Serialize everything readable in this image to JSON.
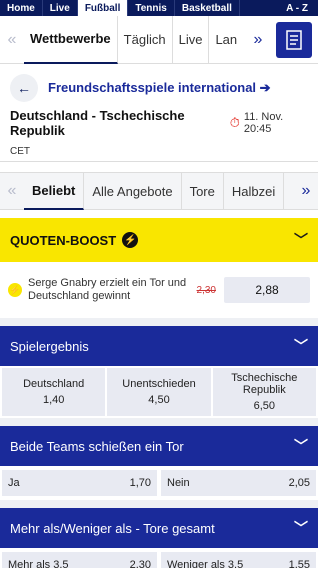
{
  "topnav": {
    "items": [
      "Home",
      "Live",
      "Fußball",
      "Tennis",
      "Basketball"
    ],
    "az": "A - Z"
  },
  "subnav": {
    "tabs": [
      "Wettbewerbe",
      "Täglich",
      "Live",
      "Lan"
    ]
  },
  "event": {
    "competition": "Freundschaftsspiele international",
    "match": "Deutschland - Tschechische Republik",
    "date": "11. Nov. 20:45",
    "tz": "CET"
  },
  "market_tabs": [
    "Beliebt",
    "Alle Angebote",
    "Tore",
    "Halbzei"
  ],
  "boost": {
    "title": "QUOTEN-BOOST",
    "text": "Serge Gnabry erzielt ein Tor und Deutschland gewinnt",
    "old_odds": "2,30",
    "odds": "2,88"
  },
  "markets": {
    "result": {
      "title": "Spielergebnis",
      "home": {
        "label": "Deutschland",
        "odds": "1,40"
      },
      "draw": {
        "label": "Unentschieden",
        "odds": "4,50"
      },
      "away": {
        "label": "Tschechische Republik",
        "odds": "6,50"
      }
    },
    "btts": {
      "title": "Beide Teams schießen ein Tor",
      "yes": {
        "label": "Ja",
        "odds": "1,70"
      },
      "no": {
        "label": "Nein",
        "odds": "2,05"
      }
    },
    "ou": {
      "title": "Mehr als/Weniger als - Tore gesamt",
      "over": {
        "label": "Mehr als 3.5",
        "odds": "2,30"
      },
      "under": {
        "label": "Weniger als 3.5",
        "odds": "1,55"
      }
    }
  },
  "colors": {
    "navy": "#0a1a5c",
    "blue": "#1a2a9a",
    "yellow": "#f9e600",
    "red": "#e2231a"
  }
}
